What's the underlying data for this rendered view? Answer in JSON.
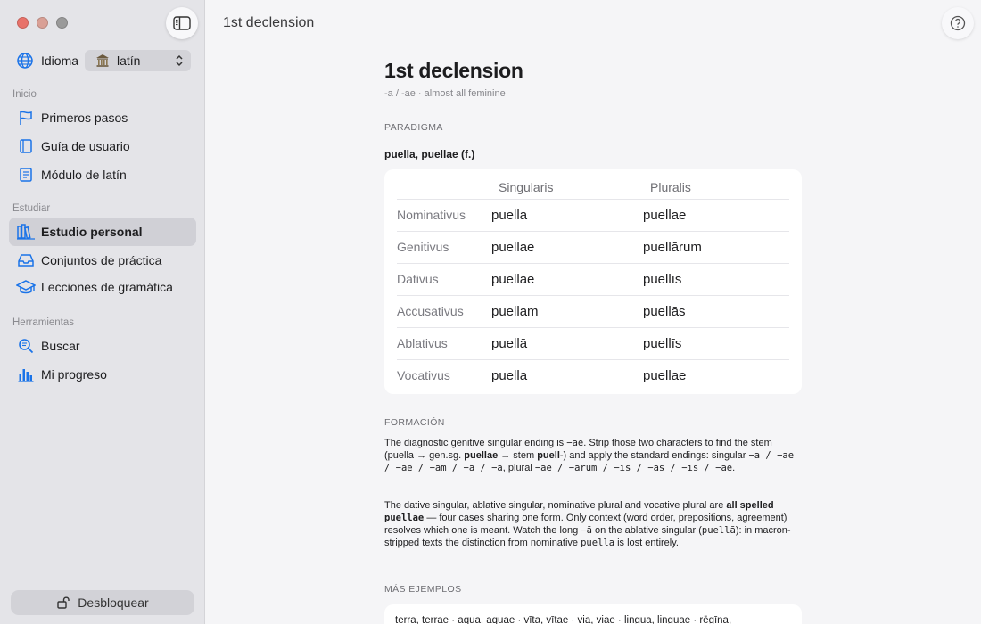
{
  "sidebar": {
    "language_label": "Idioma",
    "language_value": "latín",
    "sections": [
      {
        "title": "Inicio",
        "items": [
          {
            "label": "Primeros pasos",
            "icon": "flag-icon"
          },
          {
            "label": "Guía de usuario",
            "icon": "book-icon"
          },
          {
            "label": "Módulo de latín",
            "icon": "document-icon"
          }
        ]
      },
      {
        "title": "Estudiar",
        "items": [
          {
            "label": "Estudio personal",
            "icon": "books-icon",
            "active": true
          },
          {
            "label": "Conjuntos de práctica",
            "icon": "tray-icon"
          },
          {
            "label": "Lecciones de gramática",
            "icon": "graduation-cap-icon"
          }
        ]
      },
      {
        "title": "Herramientas",
        "items": [
          {
            "label": "Buscar",
            "icon": "search-icon"
          },
          {
            "label": "Mi progreso",
            "icon": "chart-icon"
          }
        ]
      }
    ],
    "unlock_label": "Desbloquear"
  },
  "main": {
    "window_title": "1st declension",
    "heading": "1st declension",
    "subtitle": "-a / -ae · almost all feminine",
    "paradigm_caption": "PARADIGMA",
    "paradigm_title": "puella, puellae (f.)",
    "table": {
      "headers": [
        "",
        "Singularis",
        "Pluralis"
      ],
      "rows": [
        {
          "case": "Nominativus",
          "sg": "puella",
          "pl": "puellae"
        },
        {
          "case": "Genitivus",
          "sg": "puellae",
          "pl": "puellārum"
        },
        {
          "case": "Dativus",
          "sg": "puellae",
          "pl": "puellīs"
        },
        {
          "case": "Accusativus",
          "sg": "puellam",
          "pl": "puellās"
        },
        {
          "case": "Ablativus",
          "sg": "puellā",
          "pl": "puellīs"
        },
        {
          "case": "Vocativus",
          "sg": "puella",
          "pl": "puellae"
        }
      ]
    },
    "formation_caption": "FORMACIÓN",
    "formation": {
      "p1_a": "The diagnostic genitive singular ending is ",
      "p1_code1": "−ae",
      "p1_b": ". Strip those two characters to find the stem (puella → gen.sg. ",
      "p1_bold1": "puellae",
      "p1_c": " → stem ",
      "p1_bold2": "puell-",
      "p1_d": ") and apply the standard endings: singular ",
      "p1_code2": "−a / −ae / −ae / −am / −ā / −a",
      "p1_e": ", plural ",
      "p1_code3": "−ae / −ārum / −īs / −ās / −īs / −ae",
      "p1_f": ".",
      "p2_a": "The dative singular, ablative singular, nominative plural and vocative plural are ",
      "p2_bold1": "all spelled",
      "p2_code1": "puellae",
      "p2_b": " — four cases sharing one form. Only context (word order, prepositions, agreement) resolves which one is meant. Watch the long ",
      "p2_c1": "−ā",
      "p2_c": " on the ablative singular (",
      "p2_code2": "puellā",
      "p2_d": "): in macron-stripped texts the distinction from nominative ",
      "p2_code3": "puella",
      "p2_e": " is lost entirely."
    },
    "examples_caption": "MÁS EJEMPLOS",
    "examples": "terra, terrae · aqua, aquae · vīta, vītae · via, viae · lingua, linguae · rēgīna,"
  }
}
